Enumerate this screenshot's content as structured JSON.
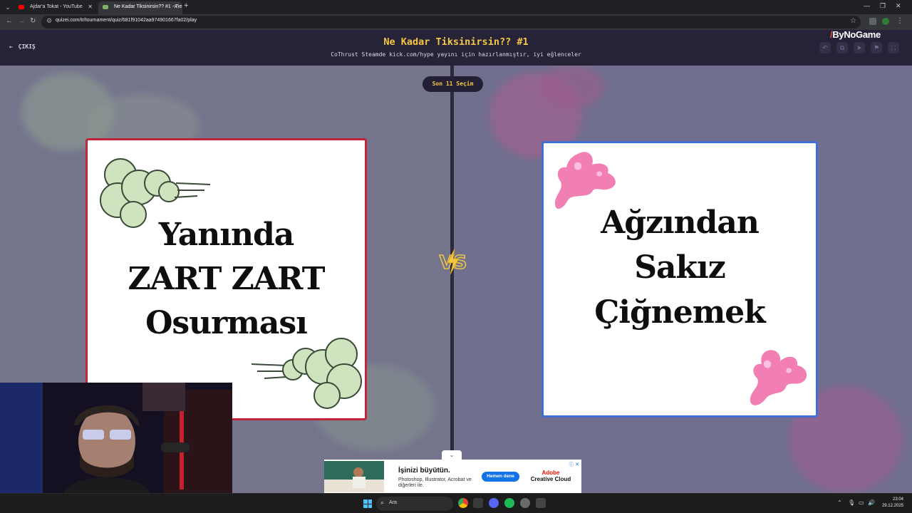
{
  "browser": {
    "tabs": [
      {
        "title": "Ajdar'a Tokat - YouTube",
        "active": false
      },
      {
        "title": "Ne Kadar Tiksinirsin?? #1 - Tie",
        "active": true
      }
    ],
    "url": "quizei.com/tr/tournament/quiz/681f91042aa974901667fa02/play"
  },
  "header": {
    "exit_label": "ÇIKIŞ",
    "title": "Ne Kadar Tiksinirsin?? #1",
    "subtitle": "CoThrust Steamde kick.com/hype yayını için hazırlanmıştır, iyi eğlenceler",
    "icons": [
      "undo-icon",
      "share-icon",
      "send-icon",
      "flag-icon",
      "fullscreen-icon"
    ]
  },
  "overlay": {
    "brand_prefix": "/",
    "brand_name": "ByNoGame"
  },
  "game": {
    "round_label": "Son 11 Seçim",
    "vs_label": "VS",
    "left_option": {
      "lines": [
        "Yanında",
        "ZART ZART",
        "Osurması"
      ]
    },
    "right_option": {
      "lines": [
        "Ağzından",
        "Sakız",
        "Çiğnemek"
      ]
    }
  },
  "ad": {
    "collapse_icon": "chevron-down-icon",
    "headline": "İşinizi büyütün.",
    "body": "Photoshop, Illustrator, Acrobat ve diğerleri ile.",
    "cta": "Hemen dene",
    "brand_line1": "Adobe",
    "brand_line2": "Creative Cloud"
  },
  "taskbar": {
    "search_label": "Ara",
    "time": "23:04",
    "date": "29.12.2025"
  },
  "colors": {
    "header_bg": "#262238",
    "title_accent": "#f5c842",
    "left_border": "#c0243a",
    "right_border": "#3f6fd8",
    "arena_bg": "#74758d"
  }
}
